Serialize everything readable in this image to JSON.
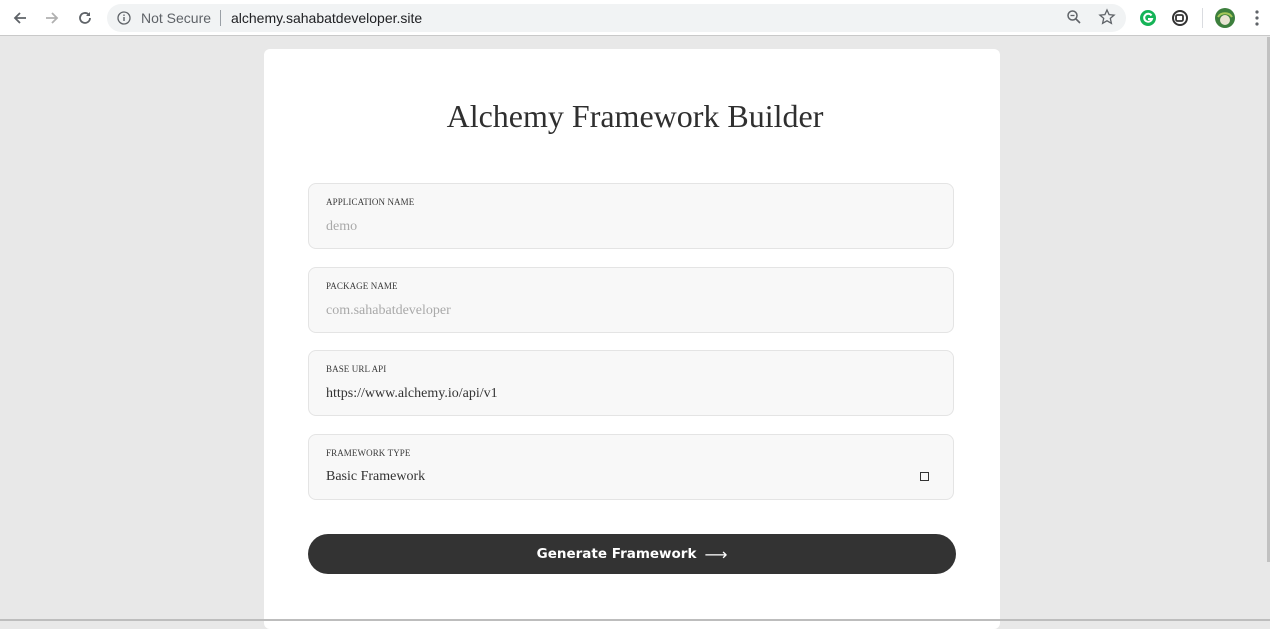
{
  "browser": {
    "security_label": "Not Secure",
    "url": "alchemy.sahabatdeveloper.site"
  },
  "page": {
    "title": "Alchemy Framework Builder",
    "fields": [
      {
        "label": "APPLICATION NAME",
        "value": "",
        "placeholder": "demo"
      },
      {
        "label": "PACKAGE NAME",
        "value": "",
        "placeholder": "com.sahabatdeveloper"
      },
      {
        "label": "BASE URL API",
        "value": "https://www.alchemy.io/api/v1",
        "placeholder": ""
      },
      {
        "label": "FRAMEWORK TYPE",
        "value": "Basic Framework"
      }
    ],
    "generate_label": "Generate Framework",
    "generate_arrow": "⟶"
  },
  "colors": {
    "button_bg": "#333333",
    "page_bg": "#e8e8e8",
    "card_bg": "#ffffff",
    "field_bg": "#f8f8f8"
  },
  "icons": [
    "back-arrow-icon",
    "forward-arrow-icon",
    "reload-icon",
    "info-icon",
    "zoom-icon",
    "star-icon",
    "grammarly-icon",
    "extension-icon",
    "profile-avatar",
    "menu-dots-icon"
  ]
}
